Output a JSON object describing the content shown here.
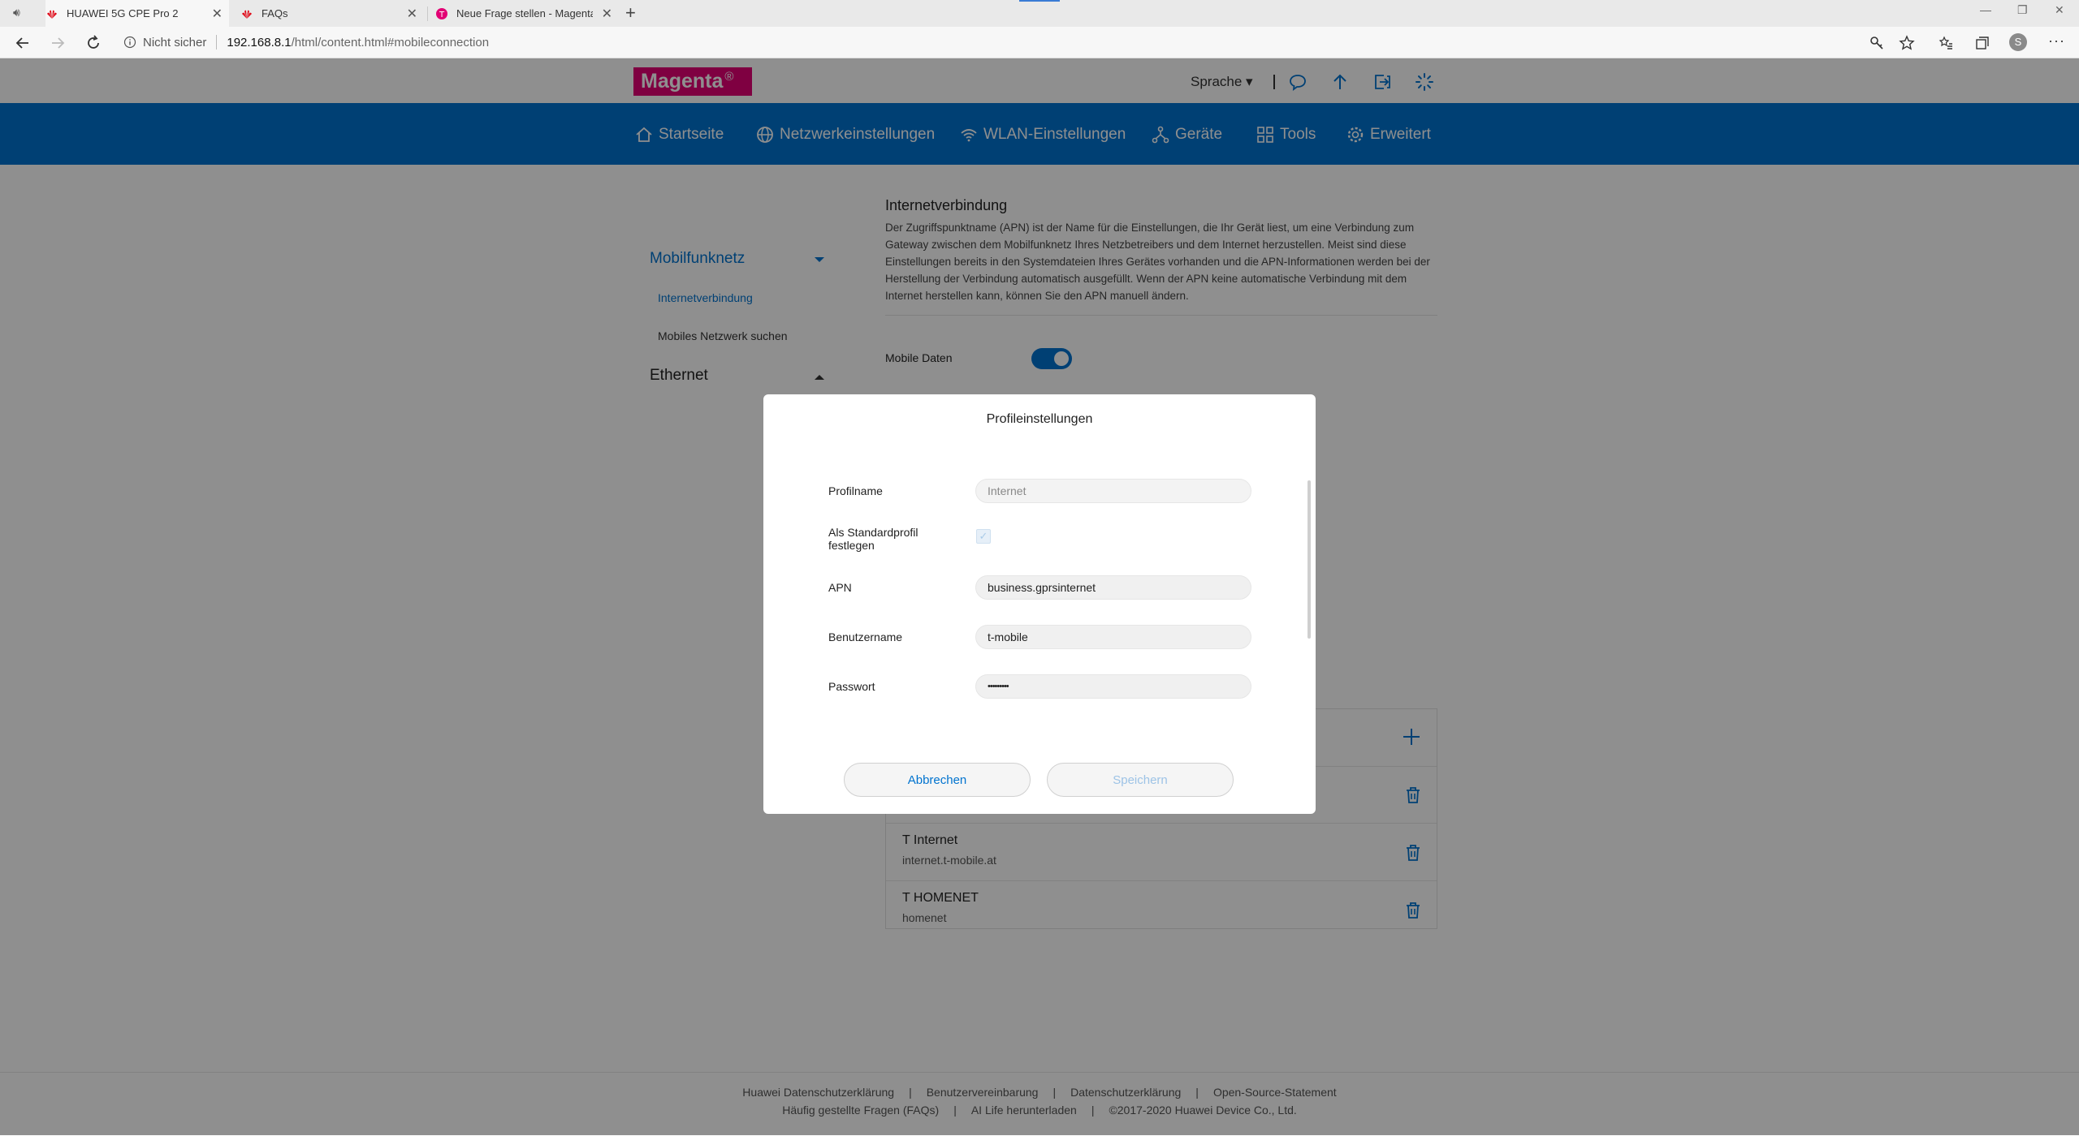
{
  "browser": {
    "tabs": [
      {
        "title": "HUAWEI 5G CPE Pro 2",
        "active": true
      },
      {
        "title": "FAQs",
        "active": false
      },
      {
        "title": "Neue Frage stellen - Magenta Co",
        "active": false
      }
    ],
    "security_label": "Nicht sicher",
    "url_host": "192.168.8.1",
    "url_path": "/html/content.html#mobileconnection",
    "profile_initial": "S"
  },
  "header": {
    "logo_text": "Magenta",
    "logo_mark": "®",
    "language_label": "Sprache ▾"
  },
  "mainnav": [
    {
      "label": "Startseite",
      "icon": "home-icon"
    },
    {
      "label": "Netzwerkeinstellungen",
      "icon": "globe-icon",
      "active": true
    },
    {
      "label": "WLAN-Einstellungen",
      "icon": "wifi-icon"
    },
    {
      "label": "Geräte",
      "icon": "devices-icon"
    },
    {
      "label": "Tools",
      "icon": "tools-icon"
    },
    {
      "label": "Erweitert",
      "icon": "gear-icon"
    }
  ],
  "sidebar": {
    "section1": "Mobilfunknetz",
    "items": [
      "Internetverbindung",
      "Mobiles Netzwerk suchen"
    ],
    "section2": "Ethernet"
  },
  "main": {
    "title": "Internetverbindung",
    "description": "Der Zugriffspunktname (APN) ist der Name für die Einstellungen, die Ihr Gerät liest, um eine Verbindung zum Gateway zwischen dem Mobilfunknetz Ihres Netzbetreibers und dem Internet herzustellen. Meist sind diese Einstellungen bereits in den Systemdateien Ihres Gerätes vorhanden und die APN-Informationen werden bei der Herstellung der Verbindung automatisch ausgefüllt. Wenn der APN keine automatische Verbindung mit dem Internet herstellen kann, können Sie den APN manuell ändern.",
    "mobile_data_label": "Mobile Daten",
    "mobile_data_on": true,
    "apn_list": [
      {
        "name": "T Internet",
        "apn": "internet.t-mobile.at"
      },
      {
        "name": "T HOMENET",
        "apn": "homenet"
      }
    ]
  },
  "modal": {
    "title": "Profileinstellungen",
    "profile_name_label": "Profilname",
    "profile_name_value": "Internet",
    "default_label": "Als Standardprofil festlegen",
    "default_checked": true,
    "apn_label": "APN",
    "apn_value": "business.gprsinternet",
    "username_label": "Benutzername",
    "username_value": "t-mobile",
    "password_label": "Passwort",
    "password_value": "•••••••••",
    "cancel_label": "Abbrechen",
    "save_label": "Speichern"
  },
  "footer": {
    "row1": [
      "Huawei Datenschutzerklärung",
      "Benutzervereinbarung",
      "Datenschutzerklärung",
      "Open-Source-Statement"
    ],
    "row2": [
      "Häufig gestellte Fragen (FAQs)",
      "AI Life herunterladen",
      "©2017-2020 Huawei Device Co., Ltd."
    ]
  },
  "colors": {
    "brand": "#e20074",
    "primary": "#0073cf"
  }
}
